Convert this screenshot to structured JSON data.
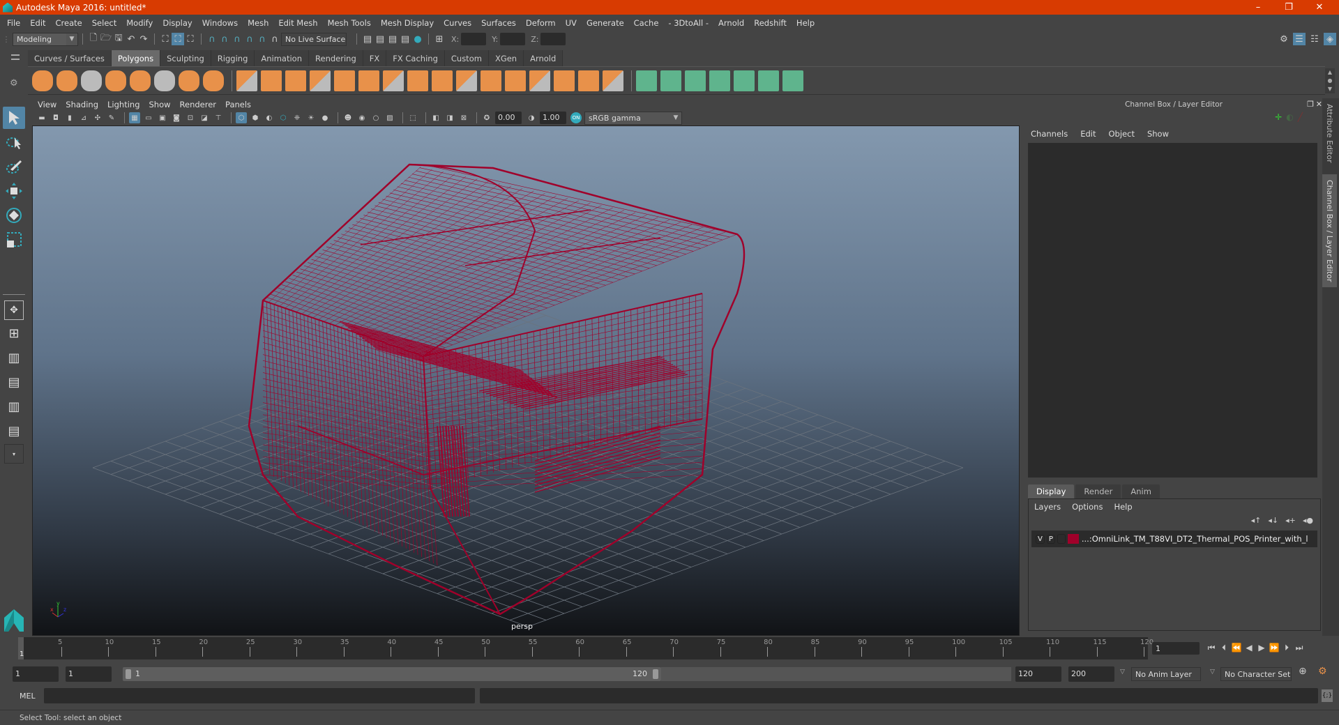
{
  "window": {
    "title": "Autodesk Maya 2016: untitled*",
    "controls": [
      "–",
      "❐",
      "✕"
    ]
  },
  "menubar": [
    "File",
    "Edit",
    "Create",
    "Select",
    "Modify",
    "Display",
    "Windows",
    "Mesh",
    "Edit Mesh",
    "Mesh Tools",
    "Mesh Display",
    "Curves",
    "Surfaces",
    "Deform",
    "UV",
    "Generate",
    "Cache",
    "- 3DtoAll -",
    "Arnold",
    "Redshift",
    "Help"
  ],
  "statusline": {
    "mode": "Modeling",
    "live_surface": "No Live Surface",
    "x_label": "X:",
    "y_label": "Y:",
    "z_label": "Z:",
    "x_value": "",
    "y_value": "",
    "z_value": ""
  },
  "shelf": {
    "tabs": [
      "Curves / Surfaces",
      "Polygons",
      "Sculpting",
      "Rigging",
      "Animation",
      "Rendering",
      "FX",
      "FX Caching",
      "Custom",
      "XGen",
      "Arnold"
    ],
    "active_tab": "Polygons",
    "icons": [
      "poly-sphere",
      "poly-cube",
      "poly-cylinder",
      "poly-cone",
      "poly-plane",
      "poly-torus",
      "poly-pyramid",
      "poly-pipe",
      "combine",
      "separate",
      "mirror",
      "smooth",
      "extract",
      "bridge",
      "fill-hole",
      "multi-cut",
      "connect",
      "bevel",
      "extrude",
      "append-to-polygon",
      "bridge-edge",
      "merge",
      "insert-edge-loop",
      "offset-edge-loop",
      "uv-planar",
      "uv-cylindrical",
      "uv-spherical",
      "uv-automatic",
      "uv-unfold",
      "uv-editor",
      "uv-layout"
    ]
  },
  "viewport": {
    "menu": [
      "View",
      "Shading",
      "Lighting",
      "Show",
      "Renderer",
      "Panels"
    ],
    "exposure": "0.00",
    "gamma": "1.00",
    "color_space": "sRGB gamma",
    "camera_label": "persp",
    "axis": {
      "x": "x",
      "y": "y",
      "z": "z"
    },
    "wireframe_color": "#a0002a"
  },
  "channelbox": {
    "title": "Channel Box / Layer Editor",
    "menu": [
      "Channels",
      "Edit",
      "Object",
      "Show"
    ],
    "layer_tabs": [
      "Display",
      "Render",
      "Anim"
    ],
    "active_layer_tab": "Display",
    "layer_menu": [
      "Layers",
      "Options",
      "Help"
    ],
    "layers": [
      {
        "visible": "V",
        "playback": "P",
        "color": "#a0002a",
        "name": "...:OmniLink_TM_T88VI_DT2_Thermal_POS_Printer_with_l"
      }
    ]
  },
  "side_tabs": [
    "Attribute Editor",
    "Channel Box / Layer Editor"
  ],
  "timeline": {
    "ticks": [
      5,
      10,
      15,
      20,
      25,
      30,
      35,
      40,
      45,
      50,
      55,
      60,
      65,
      70,
      75,
      80,
      85,
      90,
      95,
      100,
      105,
      110,
      115,
      120
    ],
    "current_frame": "1",
    "start": 1,
    "end": 120
  },
  "range": {
    "anim_start": "1",
    "playback_start": "1",
    "slider_start": "1",
    "slider_end": "120",
    "playback_end": "120",
    "anim_end": "200",
    "anim_layer": "No Anim Layer",
    "character_set": "No Character Set"
  },
  "commandline": {
    "label": "MEL",
    "value": ""
  },
  "helpline": "Select Tool: select an object"
}
